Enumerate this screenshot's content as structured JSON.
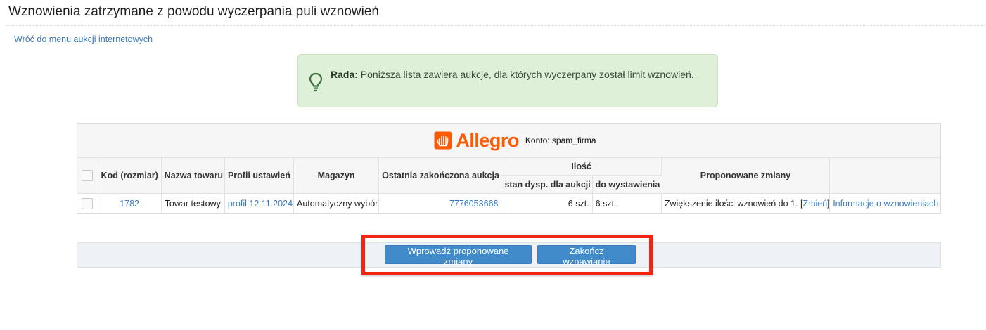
{
  "page": {
    "title": "Wznowienia zatrzymane z powodu wyczerpania puli wznowień",
    "back_link": "Wróć do menu aukcji internetowych"
  },
  "tip": {
    "label": "Rada:",
    "text": "Poniższa lista zawiera aukcje, dla których wyczerpany został limit wznowień.",
    "icon": "lightbulb-icon"
  },
  "brand": {
    "name": "Allegro",
    "account_label": "Konto: spam_firma",
    "color": "#ff5a00"
  },
  "table": {
    "headers": {
      "code": "Kod (rozmiar)",
      "product_name": "Nazwa towaru",
      "settings_profile": "Profil ustawień",
      "warehouse": "Magazyn",
      "last_auction": "Ostatnia zakończona aukcja",
      "quantity": "Ilość",
      "quantity_available": "stan dysp. dla aukcji",
      "quantity_to_list": "do wystawienia",
      "proposed_changes": "Proponowane zmiany"
    },
    "rows": [
      {
        "code": "1782",
        "product_name": "Towar testowy",
        "settings_profile": "profil 12.11.2024",
        "warehouse": "Automatyczny wybór",
        "last_auction": "7776053668",
        "quantity_available": "6 szt.",
        "quantity_to_list": "6 szt.",
        "proposed_change": "Zwiększenie ilości wznowień do 1.",
        "change_link": "Zmień",
        "info_link": "Informacje o wznowieniach"
      }
    ]
  },
  "actions": {
    "apply": "Wprowadź proponowane zmiany",
    "finish": "Zakończ wznawianie"
  },
  "colors": {
    "link": "#3a7bbf",
    "button": "#428bca",
    "tip_background": "#dff0d8",
    "highlight": "#f4250f"
  }
}
